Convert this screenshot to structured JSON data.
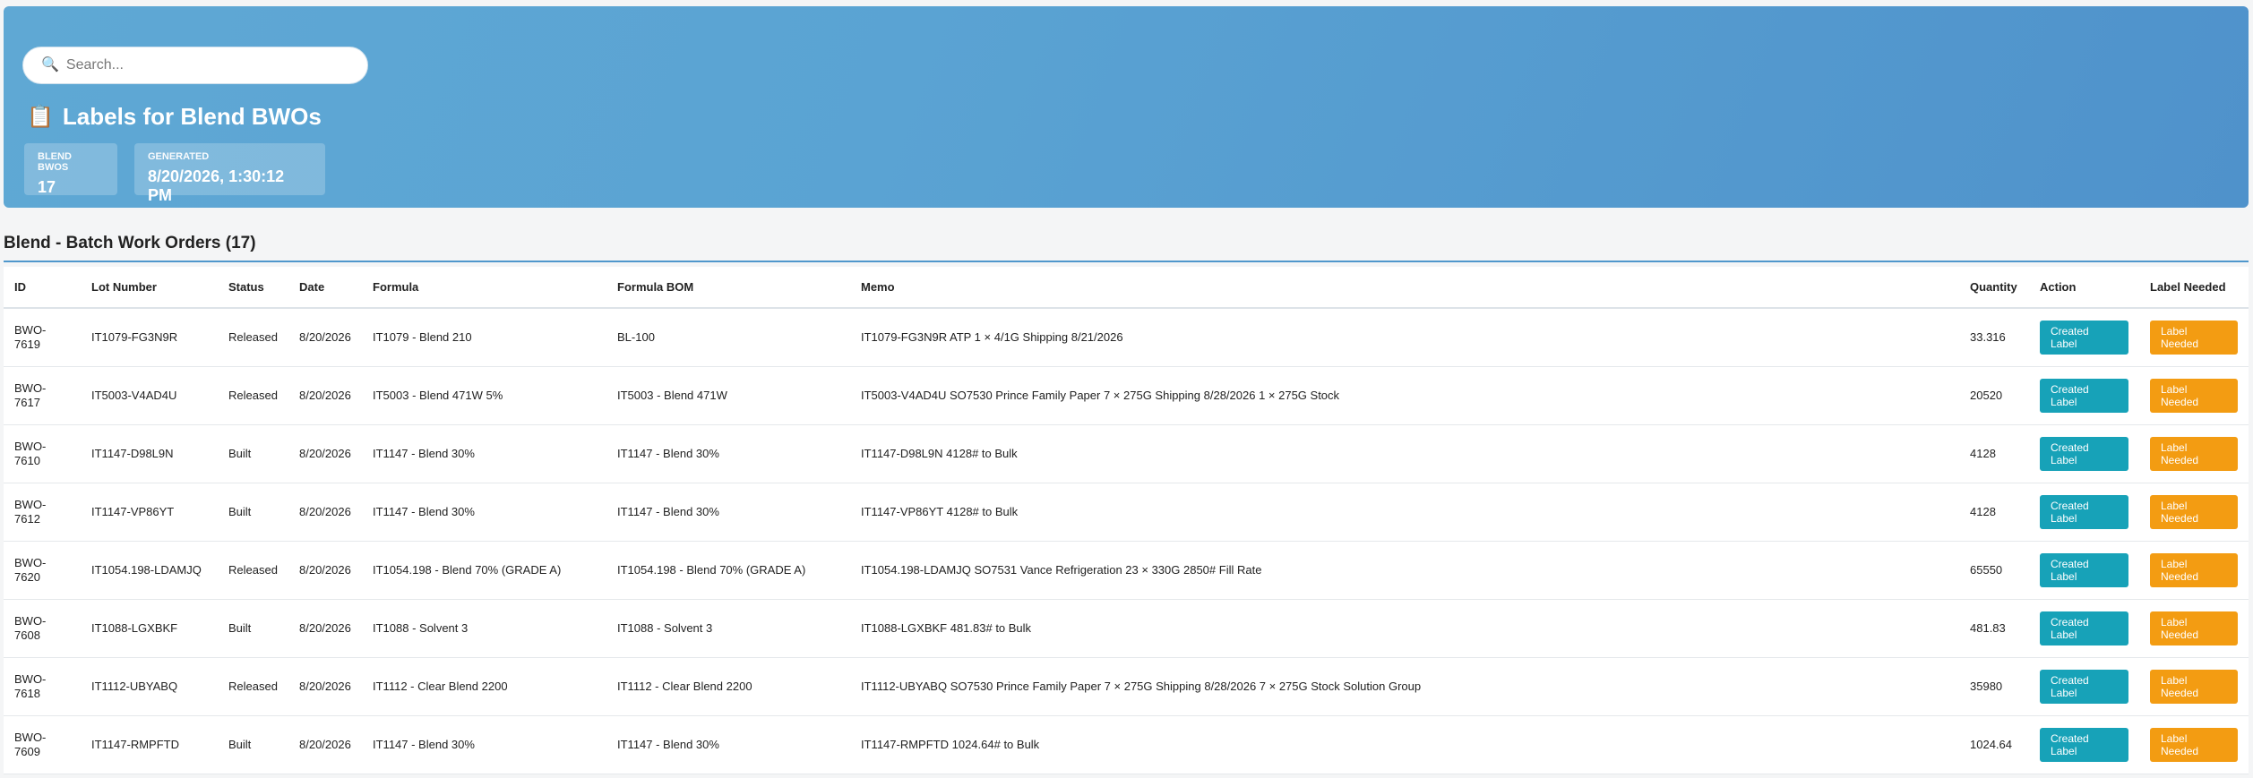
{
  "search": {
    "placeholder": "Search..."
  },
  "header": {
    "title": "Labels for Blend BWOs",
    "stats": [
      {
        "label": "Blend BWOs",
        "value": "17"
      },
      {
        "label": "Generated",
        "value": "8/20/2026, 1:30:12 PM"
      }
    ]
  },
  "section": {
    "title": "Blend - Batch Work Orders (17)"
  },
  "table": {
    "columns": [
      "ID",
      "Lot Number",
      "Status",
      "Date",
      "Formula",
      "Formula BOM",
      "Memo",
      "Quantity",
      "Action",
      "Label Needed"
    ],
    "rows": [
      {
        "id": "BWO-7619",
        "lot": "IT1079-FG3N9R",
        "status": "Released",
        "date": "8/20/2026",
        "formula": "IT1079 - Blend 210",
        "bom": "BL-100",
        "memo": "IT1079-FG3N9R ATP 1 × 4/1G Shipping 8/21/2026",
        "qty": "33.316",
        "action": "Created Label",
        "label": "Label Needed"
      },
      {
        "id": "BWO-7617",
        "lot": "IT5003-V4AD4U",
        "status": "Released",
        "date": "8/20/2026",
        "formula": "IT5003 - Blend 471W 5%",
        "bom": "IT5003 - Blend 471W",
        "memo": "IT5003-V4AD4U SO7530 Prince Family Paper 7 × 275G Shipping 8/28/2026 1 × 275G Stock",
        "qty": "20520",
        "action": "Created Label",
        "label": "Label Needed"
      },
      {
        "id": "BWO-7610",
        "lot": "IT1147-D98L9N",
        "status": "Built",
        "date": "8/20/2026",
        "formula": "IT1147 - Blend 30%",
        "bom": "IT1147 - Blend 30%",
        "memo": "IT1147-D98L9N 4128# to Bulk",
        "qty": "4128",
        "action": "Created Label",
        "label": "Label Needed"
      },
      {
        "id": "BWO-7612",
        "lot": "IT1147-VP86YT",
        "status": "Built",
        "date": "8/20/2026",
        "formula": "IT1147 - Blend 30%",
        "bom": "IT1147 - Blend 30%",
        "memo": "IT1147-VP86YT 4128# to Bulk",
        "qty": "4128",
        "action": "Created Label",
        "label": "Label Needed"
      },
      {
        "id": "BWO-7620",
        "lot": "IT1054.198-LDAMJQ",
        "status": "Released",
        "date": "8/20/2026",
        "formula": "IT1054.198 - Blend 70% (GRADE A)",
        "bom": "IT1054.198 - Blend 70% (GRADE A)",
        "memo": "IT1054.198-LDAMJQ SO7531 Vance Refrigeration 23 × 330G 2850# Fill Rate",
        "qty": "65550",
        "action": "Created Label",
        "label": "Label Needed"
      },
      {
        "id": "BWO-7608",
        "lot": "IT1088-LGXBKF",
        "status": "Built",
        "date": "8/20/2026",
        "formula": "IT1088 - Solvent 3",
        "bom": "IT1088 - Solvent 3",
        "memo": "IT1088-LGXBKF 481.83# to Bulk",
        "qty": "481.83",
        "action": "Created Label",
        "label": "Label Needed"
      },
      {
        "id": "BWO-7618",
        "lot": "IT1112-UBYABQ",
        "status": "Released",
        "date": "8/20/2026",
        "formula": "IT1112 - Clear Blend 2200",
        "bom": "IT1112 - Clear Blend 2200",
        "memo": "IT1112-UBYABQ SO7530 Prince Family Paper 7 × 275G Shipping 8/28/2026 7 × 275G Stock Solution Group",
        "qty": "35980",
        "action": "Created Label",
        "label": "Label Needed"
      },
      {
        "id": "BWO-7609",
        "lot": "IT1147-RMPFTD",
        "status": "Built",
        "date": "8/20/2026",
        "formula": "IT1147 - Blend 30%",
        "bom": "IT1147 - Blend 30%",
        "memo": "IT1147-RMPFTD 1024.64# to Bulk",
        "qty": "1024.64",
        "action": "Created Label",
        "label": "Label Needed"
      }
    ]
  },
  "colors": {
    "header_bg": "#5aa3d3",
    "created_btn": "#17a2b8",
    "needed_btn": "#f39c12"
  },
  "icons": {
    "search": "search-icon",
    "title": "clipboard-icon"
  }
}
